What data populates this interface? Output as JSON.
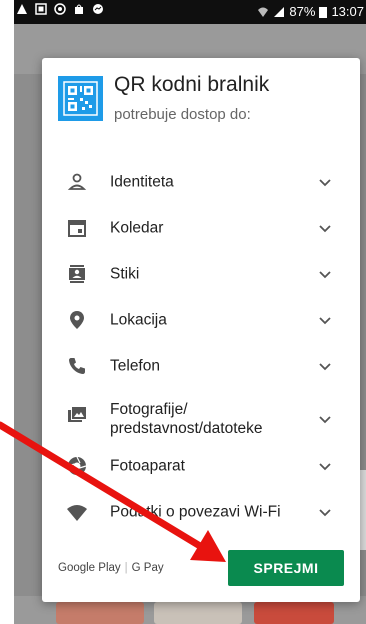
{
  "statusbar": {
    "battery": "87%",
    "time": "13:07"
  },
  "dialog": {
    "app_name": "QR kodni bralnik",
    "subtitle": "potrebuje dostop do:",
    "permissions": [
      {
        "label": "Identiteta",
        "icon": "person-icon"
      },
      {
        "label": "Koledar",
        "icon": "calendar-icon"
      },
      {
        "label": "Stiki",
        "icon": "contacts-icon"
      },
      {
        "label": "Lokacija",
        "icon": "location-pin-icon"
      },
      {
        "label": "Telefon",
        "icon": "phone-icon"
      },
      {
        "label": "Fotografije/\npredstavnost/datoteke",
        "icon": "photo-icon"
      },
      {
        "label": "Fotoaparat",
        "icon": "camera-shutter-icon"
      },
      {
        "label": "Podatki o povezavi Wi-Fi",
        "icon": "wifi-icon"
      }
    ],
    "brand_play": "Google Play",
    "brand_pay": "G Pay",
    "accept_label": "SPREJMI"
  },
  "colors": {
    "accept": "#0a8a4f",
    "app_icon": "#1e9be8",
    "annotation_arrow": "#e8130f"
  }
}
